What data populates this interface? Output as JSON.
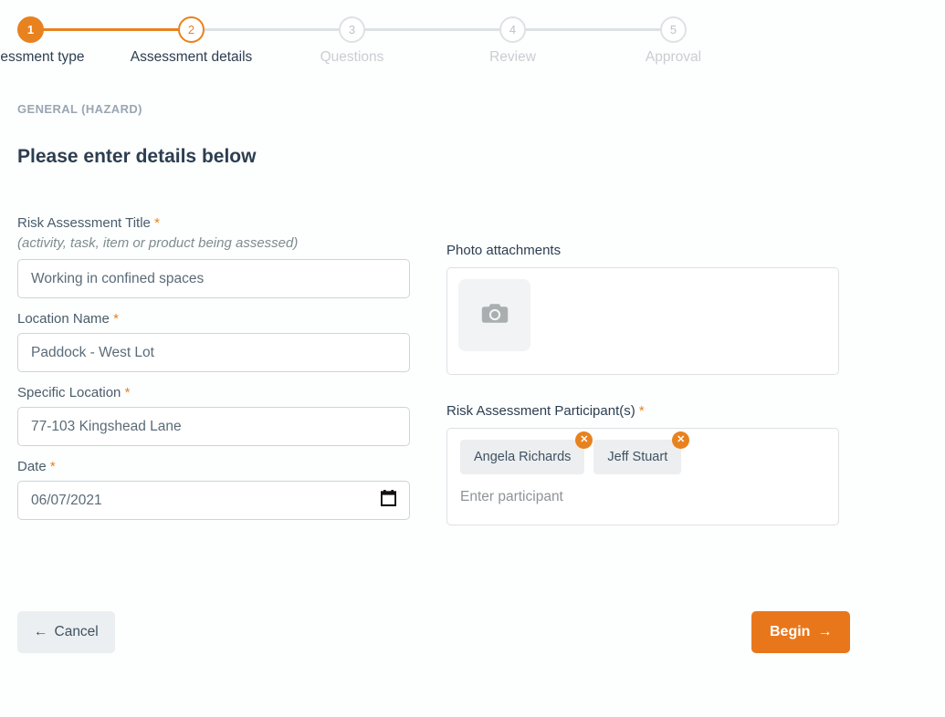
{
  "stepper": {
    "steps": [
      {
        "number": "1",
        "label": "Assessment type",
        "state": "complete"
      },
      {
        "number": "2",
        "label": "Assessment details",
        "state": "current"
      },
      {
        "number": "3",
        "label": "Questions",
        "state": "upcoming"
      },
      {
        "number": "4",
        "label": "Review",
        "state": "upcoming"
      },
      {
        "number": "5",
        "label": "Approval",
        "state": "upcoming"
      }
    ],
    "accent_color": "#e8821e",
    "inactive_color": "#dfe2e4"
  },
  "header": {
    "eyebrow": "GENERAL (HAZARD)",
    "title": "Please enter details below"
  },
  "form": {
    "title_field": {
      "label": "Risk Assessment Title",
      "required_marker": "*",
      "hint": "(activity, task, item or product being assessed)",
      "value": "Working in confined spaces"
    },
    "location_name": {
      "label": "Location Name",
      "required_marker": "*",
      "value": "Paddock - West Lot"
    },
    "specific_location": {
      "label": "Specific Location",
      "required_marker": "*",
      "value": "77-103 Kingshead Lane"
    },
    "date": {
      "label": "Date",
      "required_marker": "*",
      "value": "06/07/2021",
      "icon": "calendar-icon"
    }
  },
  "photo_attachments": {
    "label": "Photo attachments",
    "tile_icon": "camera-icon"
  },
  "participants": {
    "label": "Risk Assessment Participant(s)",
    "required_marker": "*",
    "chips": [
      {
        "name": "Angela Richards",
        "remove_icon": "✕"
      },
      {
        "name": "Jeff Stuart",
        "remove_icon": "✕"
      }
    ],
    "input_placeholder": "Enter participant"
  },
  "footer": {
    "cancel_label": "Cancel",
    "cancel_arrow": "←",
    "begin_label": "Begin",
    "begin_arrow": "→",
    "begin_color": "#e8771c"
  }
}
